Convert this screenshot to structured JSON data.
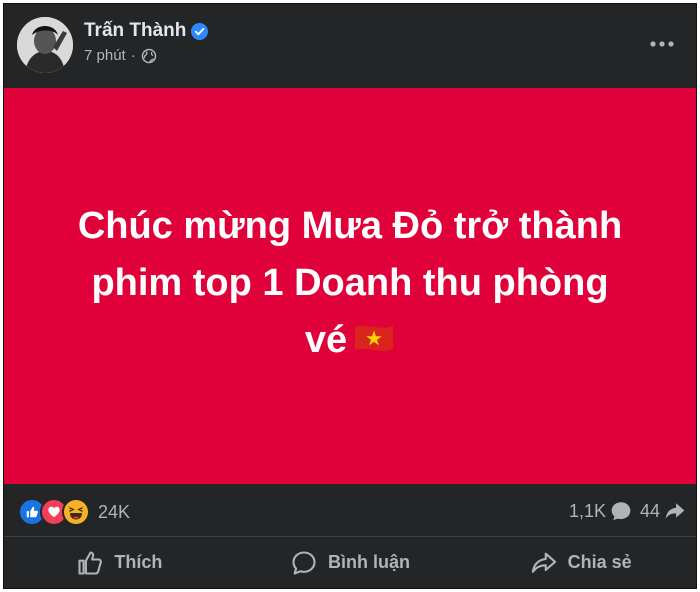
{
  "post": {
    "author": "Trấn Thành",
    "time": "7 phút",
    "separator": "·",
    "text_lines": [
      "Chúc mừng Mưa Đỏ trở thành",
      "phim top 1 Doanh thu phòng",
      "vé"
    ],
    "image_bg": "#e0013a",
    "icons": {
      "verified": "verified-badge-icon",
      "privacy": "globe-icon",
      "more": "more-options-icon"
    }
  },
  "stats": {
    "reactions": [
      "like",
      "love",
      "haha"
    ],
    "reaction_count": "24K",
    "comment_count": "1,1K",
    "share_count": "44"
  },
  "actions": {
    "like": "Thích",
    "comment": "Bình luận",
    "share": "Chia sẻ"
  },
  "colors": {
    "like_blue": "#1b74e4",
    "love_red": "#f33e58",
    "haha_yellow": "#f7b125",
    "verified_blue": "#2d88ff"
  }
}
